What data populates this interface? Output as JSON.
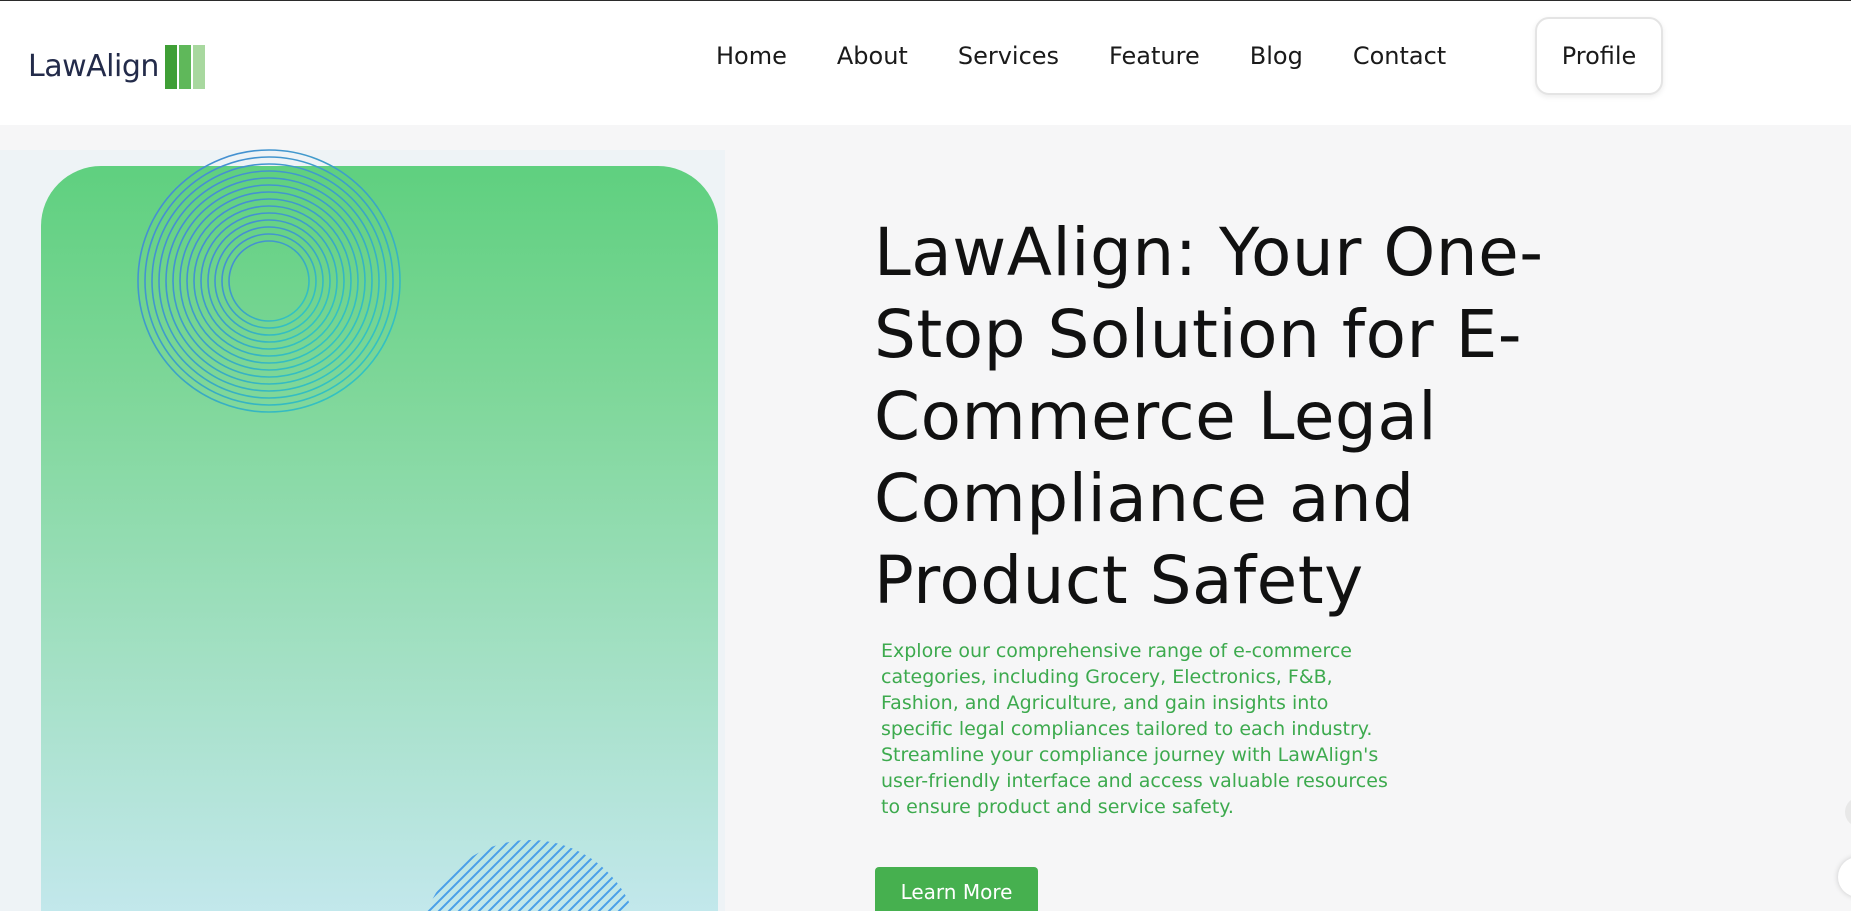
{
  "brand": {
    "logo_text": "LawAlign",
    "logo_bar_colors": [
      "#3f9f36",
      "#5fb85a",
      "#a8d89f"
    ]
  },
  "nav": {
    "items": [
      "Home",
      "About",
      "Services",
      "Feature",
      "Blog",
      "Contact"
    ],
    "profile_label": "Profile"
  },
  "hero": {
    "title": "LawAlign: Your One-Stop Solution for E-Commerce Legal Compliance and Product Safety",
    "description": "Explore our comprehensive range of e-commerce categories, including Grocery, Electronics, F&B, Fashion, and Agriculture, and gain insights into specific legal compliances tailored to each industry. Streamline your compliance journey with LawAlign's user-friendly interface and access valuable resources to ensure product and service safety.",
    "cta_label": "Learn More"
  },
  "colors": {
    "accent_green": "#46b04f",
    "description_green": "#3daa4e",
    "logo_navy": "#232b4a"
  },
  "icons": {
    "rings": "concentric-rings-decoration",
    "stripes": "diagonal-stripes-decoration"
  }
}
